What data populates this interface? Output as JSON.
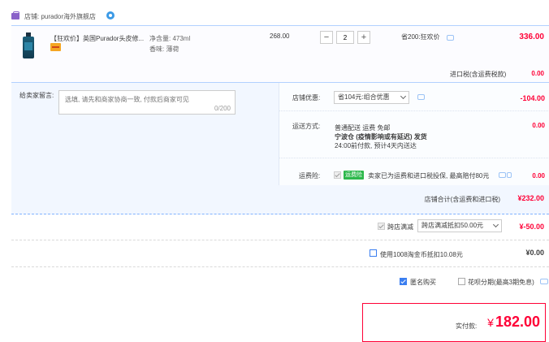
{
  "shop": {
    "label": "店铺: purador海外旗舰店"
  },
  "item": {
    "title": "【狂欢价】英国Purador头皮修...",
    "attr_volume": "净含量: 473ml",
    "attr_scent": "香味: 薄荷",
    "unit_price": "268.00",
    "quantity": "2",
    "discount_text": "省200:狂欢价",
    "line_total": "336.00",
    "import_tax_label": "进口税(含运费税款)",
    "import_tax_value": "0.00"
  },
  "message": {
    "label": "给卖家留言:",
    "placeholder": "选填, 请先和商家协商一致, 付款后商家可见",
    "count": "0/200"
  },
  "shop_promo": {
    "label": "店铺优惠:",
    "selected": "省104元:组合优惠",
    "value": "-104.00"
  },
  "shipping": {
    "label": "运送方式:",
    "line1": "普通配送 运费 免邮",
    "line2": "宁波仓 (疫情影响或有延迟)   发货",
    "line3": "24:00前付款, 预计4天内送达",
    "value": "0.00"
  },
  "insurance": {
    "label": "运费险:",
    "badge": "运费险",
    "text": "卖家已为运费和进口税投保, 最高赔付80元",
    "value": "0.00"
  },
  "shop_total": {
    "label": "店铺合计(含运费和进口税)",
    "value": "¥232.00"
  },
  "cross_store": {
    "label": "跨店满减",
    "selected": "跨店满减抵扣50.00元",
    "value": "¥-50.00"
  },
  "taojinbi": {
    "label": "使用1008淘金币抵扣10.08元",
    "value": "¥0.00"
  },
  "anonymous": {
    "label": "匿名购买"
  },
  "huabei": {
    "label": "花呗分期(最高3期免息)"
  },
  "actual_pay": {
    "label": "实付款:",
    "currency": "¥",
    "value": "182.00"
  },
  "colors": {
    "accent_red": "#ff0036",
    "border_blue": "#b2d1ff",
    "check_blue": "#3a7ef0",
    "badge_green": "#2db84c"
  }
}
